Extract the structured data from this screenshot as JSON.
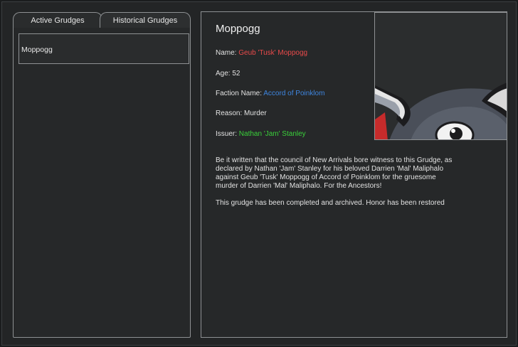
{
  "tabs": [
    {
      "label": "Active Grudges"
    },
    {
      "label": "Historical Grudges"
    }
  ],
  "list": {
    "items": [
      {
        "label": "Moppogg"
      }
    ]
  },
  "detail": {
    "title": "Moppogg",
    "name_label": "Name:",
    "name_value": "Geub 'Tusk' Moppogg",
    "age_label": "Age:",
    "age_value": "52",
    "faction_label": "Faction Name:",
    "faction_value": "Accord of Poinklom",
    "reason_label": "Reason:",
    "reason_value": "Murder",
    "issuer_label": "Issuer:",
    "issuer_value": "Nathan 'Jam' Stanley",
    "description": "Be it written that the council of New Arrivals bore witness to this Grudge, as declared by Nathan 'Jam' Stanley for his beloved Darrien 'Mal' Maliphalo against Geub 'Tusk' Moppogg of Accord of Poinklom for the gruesome murder of Darrien 'Mal' Maliphalo. For the Ancestors!",
    "status": "This grudge has been completed and archived. Honor has been restored"
  },
  "colors": {
    "name_value": "#e84a4a",
    "faction_value": "#3e86e0",
    "issuer_value": "#3ad03a"
  },
  "portrait": {
    "icon": "creature-portrait-icon"
  }
}
